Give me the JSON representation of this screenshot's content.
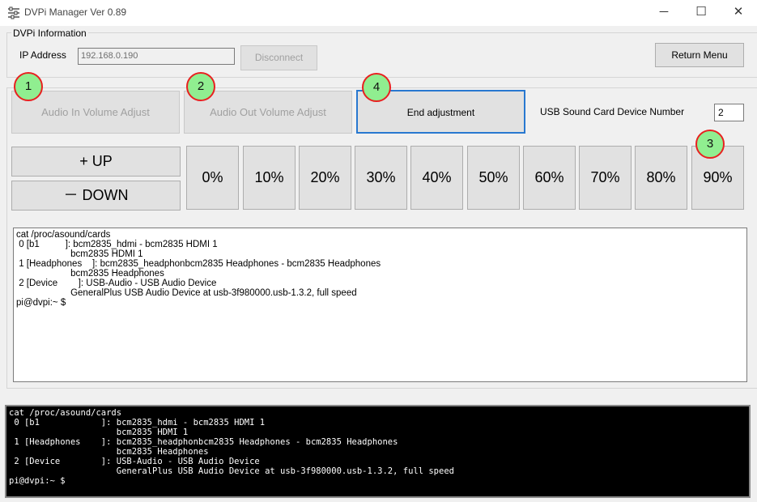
{
  "window": {
    "title": "DVPi Manager Ver 0.89",
    "minimize": "─",
    "maximize": "☐",
    "close": "✕"
  },
  "info_group": {
    "label": "DVPi Information",
    "ip_label": "IP Address",
    "ip_value": "192.168.0.190",
    "disconnect": "Disconnect",
    "return_menu": "Return Menu"
  },
  "adjust": {
    "audio_in": "Audio In Volume Adjust",
    "audio_out": "Audio Out Volume Adjust",
    "end": "End adjustment",
    "usb_label": "USB Sound Card Device Number",
    "usb_value": "2",
    "up": "+ UP",
    "down": "－ DOWN",
    "percents": [
      "0%",
      "10%",
      "20%",
      "30%",
      "40%",
      "50%",
      "60%",
      "70%",
      "80%",
      "90%"
    ]
  },
  "output_text": "cat /proc/asound/cards\n 0 [b1          ]: bcm2835_hdmi - bcm2835 HDMI 1\n                     bcm2835 HDMI 1\n 1 [Headphones    ]: bcm2835_headphonbcm2835 Headphones - bcm2835 Headphones\n                     bcm2835 Headphones\n 2 [Device        ]: USB-Audio - USB Audio Device\n                     GeneralPlus USB Audio Device at usb-3f980000.usb-1.3.2, full speed\npi@dvpi:~ $",
  "console_text": "cat /proc/asound/cards\n 0 [b1            ]: bcm2835_hdmi - bcm2835 HDMI 1\n                     bcm2835 HDMI 1\n 1 [Headphones    ]: bcm2835_headphonbcm2835 Headphones - bcm2835 Headphones\n                     bcm2835 Headphones\n 2 [Device        ]: USB-Audio - USB Audio Device\n                     GeneralPlus USB Audio Device at usb-3f980000.usb-1.3.2, full speed\npi@dvpi:~ $",
  "markers": [
    "1",
    "2",
    "3",
    "4"
  ],
  "colors": {
    "focus_border": "#2878d0",
    "marker_fill": "#90ee90",
    "marker_ring": "#e82020"
  }
}
